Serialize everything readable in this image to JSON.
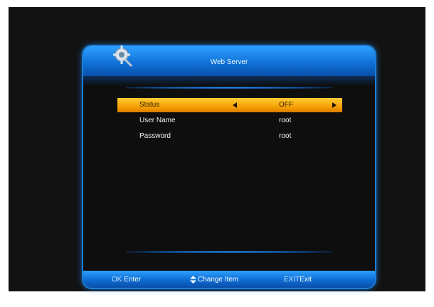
{
  "window": {
    "title": "Web Server"
  },
  "menu": {
    "items": [
      {
        "label": "Status",
        "value": "OFF"
      },
      {
        "label": "User Name",
        "value": "root"
      },
      {
        "label": "Password",
        "value": "root"
      }
    ]
  },
  "footer": {
    "ok_key": "OK",
    "ok_label": "Enter",
    "change_label": "Change Item",
    "exit_key": "EXIT",
    "exit_label": "Exit"
  },
  "icons": {
    "logo": "gear-wrench-icon",
    "left": "arrow-left-icon",
    "right": "arrow-right-icon",
    "updown": "up-down-arrows-icon"
  },
  "colors": {
    "accent_blue": "#1f8fff",
    "selection_orange": "#f39a00",
    "background": "#121212"
  }
}
